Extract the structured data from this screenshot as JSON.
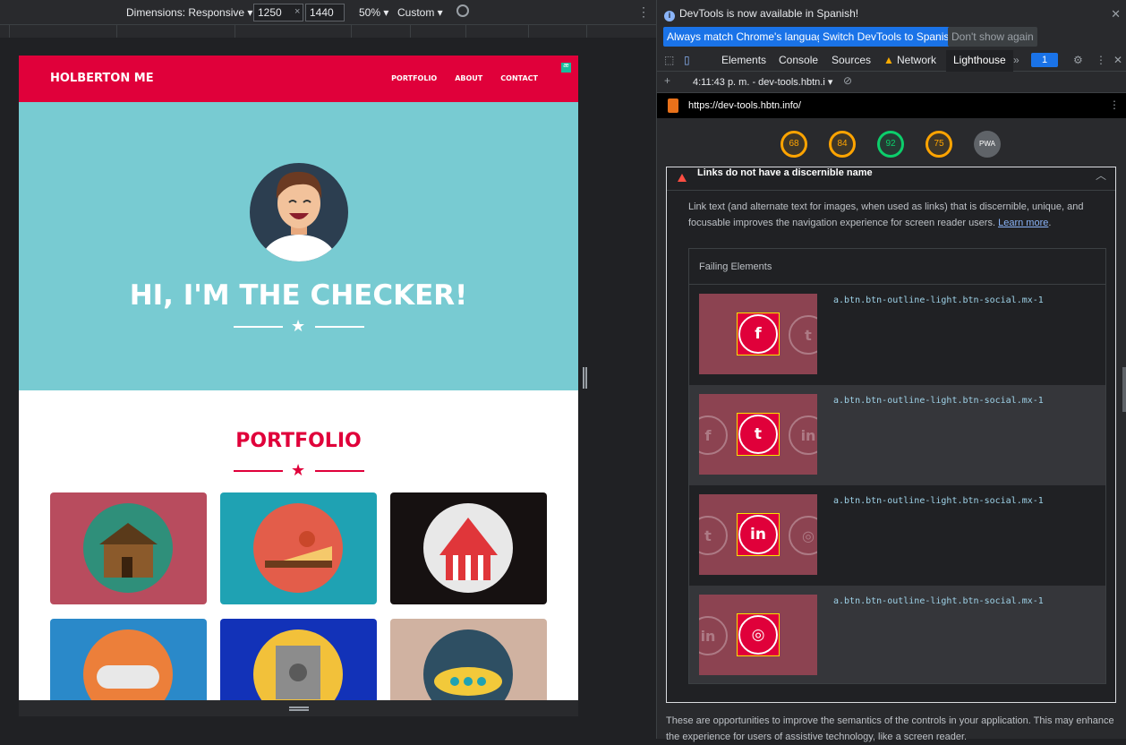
{
  "device_toolbar": {
    "dimensions_label": "Dimensions: Responsive ▾",
    "width": "1250",
    "height": "1440",
    "times": "×",
    "zoom": "50% ▾",
    "throttle": "Custom ▾"
  },
  "site": {
    "brand": "HOLBERTON ME",
    "nav": [
      "PORTFOLIO",
      "ABOUT",
      "CONTACT"
    ],
    "hero_title": "HI, I'M THE CHECKER!",
    "portfolio_title": "PORTFOLIO",
    "colors": {
      "primary": "#e0003a",
      "hero_bg": "#78cbd2"
    }
  },
  "devtools": {
    "infobar": {
      "message": "DevTools is now available in Spanish!",
      "btn_match": "Always match Chrome's language",
      "btn_switch": "Switch DevTools to Spanish",
      "btn_dismiss": "Don't show again"
    },
    "tabs": [
      "Elements",
      "Console",
      "Sources",
      "Network",
      "Lighthouse"
    ],
    "active_tab": "Lighthouse",
    "issues_count": "1",
    "report_time": "4:11:43 p. m. - dev-tools.hbtn.i ▾",
    "url": "https://dev-tools.hbtn.info/",
    "scores": [
      "68",
      "84",
      "92",
      "75"
    ],
    "pwa_label": "PWA",
    "audit": {
      "title": "Links do not have a discernible name",
      "description": "Link text (and alternate text for images, when used as links) that is discernible, unique, and focusable improves the navigation experience for screen reader users.",
      "learn_more": "Learn more",
      "failing_header": "Failing Elements",
      "items": [
        {
          "selector": "a.btn.btn-outline-light.btn-social.mx-1",
          "icon": "facebook-icon",
          "glyph": "f"
        },
        {
          "selector": "a.btn.btn-outline-light.btn-social.mx-1",
          "icon": "twitter-icon",
          "glyph": "t"
        },
        {
          "selector": "a.btn.btn-outline-light.btn-social.mx-1",
          "icon": "linkedin-icon",
          "glyph": "in"
        },
        {
          "selector": "a.btn.btn-outline-light.btn-social.mx-1",
          "icon": "dribbble-icon",
          "glyph": "◎"
        }
      ]
    },
    "footer_text": "These are opportunities to improve the semantics of the controls in your application. This may enhance the experience for users of assistive technology, like a screen reader."
  }
}
